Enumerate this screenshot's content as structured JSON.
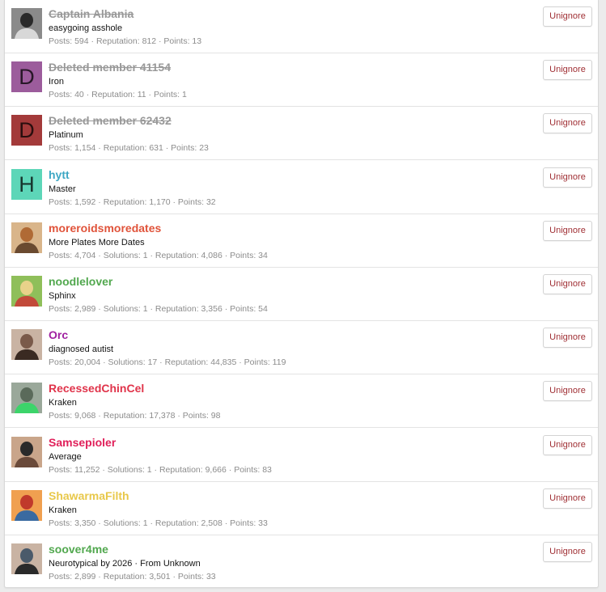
{
  "button_label": "Unignore",
  "members": [
    {
      "name": "Captain Albania",
      "deleted": true,
      "name_color": "#999999",
      "title": "easygoing asshole",
      "stats": "Posts: 594 · Reputation: 812 · Points: 13",
      "avatar": {
        "type": "photo",
        "icon": "avatar-photo-icon",
        "colors": [
          "#2a2a2a",
          "#8a8a8a",
          "#d8d8d8"
        ]
      }
    },
    {
      "name": "Deleted member 41154",
      "deleted": true,
      "name_color": "#999999",
      "title": "Iron",
      "stats": "Posts: 40 · Reputation: 11 · Points: 1",
      "avatar": {
        "type": "letter",
        "letter": "D",
        "bg": "#9c5c9c"
      }
    },
    {
      "name": "Deleted member 62432",
      "deleted": true,
      "name_color": "#999999",
      "title": "Platinum",
      "stats": "Posts: 1,154 · Reputation: 631 · Points: 23",
      "avatar": {
        "type": "letter",
        "letter": "D",
        "bg": "#a33a3a"
      }
    },
    {
      "name": "hytt",
      "deleted": false,
      "name_color": "#3ea7c4",
      "title": "Master",
      "stats": "Posts: 1,592 · Reputation: 1,170 · Points: 32",
      "avatar": {
        "type": "letter",
        "letter": "H",
        "bg": "#5dd6b8"
      }
    },
    {
      "name": "moreroidsmoredates",
      "deleted": false,
      "name_color": "#e0533a",
      "title": "More Plates More Dates",
      "stats": "Posts: 4,704 · Solutions: 1 · Reputation: 4,086 · Points: 34",
      "avatar": {
        "type": "photo",
        "icon": "avatar-photo-icon",
        "colors": [
          "#b06a35",
          "#d9b58a",
          "#6a4a30"
        ]
      }
    },
    {
      "name": "noodlelover",
      "deleted": false,
      "name_color": "#52a84f",
      "title": "Sphinx",
      "stats": "Posts: 2,989 · Solutions: 1 · Reputation: 3,356 · Points: 54",
      "avatar": {
        "type": "photo",
        "icon": "avatar-photo-icon",
        "colors": [
          "#e8d28a",
          "#8fbf5a",
          "#c24a3a"
        ]
      }
    },
    {
      "name": "Orc",
      "deleted": false,
      "name_color": "#a020a0",
      "title": "diagnosed autist",
      "stats": "Posts: 20,004 · Solutions: 17 · Reputation: 44,835 · Points: 119",
      "avatar": {
        "type": "photo",
        "icon": "avatar-photo-icon",
        "colors": [
          "#7a5a4a",
          "#c9b3a3",
          "#3a2a22"
        ]
      }
    },
    {
      "name": "RecessedChinCel",
      "deleted": false,
      "name_color": "#e0334a",
      "title": "Kraken",
      "stats": "Posts: 9,068 · Reputation: 17,378 · Points: 98",
      "avatar": {
        "type": "photo",
        "icon": "avatar-photo-icon",
        "colors": [
          "#5a6a5a",
          "#9aa89a",
          "#3cd46a"
        ]
      }
    },
    {
      "name": "Samsepioler",
      "deleted": false,
      "name_color": "#e0205a",
      "title": "Average",
      "stats": "Posts: 11,252 · Solutions: 1 · Reputation: 9,666 · Points: 83",
      "avatar": {
        "type": "photo",
        "icon": "avatar-photo-icon",
        "colors": [
          "#2a2a2a",
          "#c9a58a",
          "#6a4a3a"
        ]
      }
    },
    {
      "name": "ShawarmaFilth",
      "deleted": false,
      "name_color": "#e8c84a",
      "title": "Kraken",
      "stats": "Posts: 3,350 · Solutions: 1 · Reputation: 2,508 · Points: 33",
      "avatar": {
        "type": "photo",
        "icon": "avatar-photo-icon",
        "colors": [
          "#c0392b",
          "#f0a050",
          "#3a6aa0"
        ]
      }
    },
    {
      "name": "soover4me",
      "deleted": false,
      "name_color": "#52a84f",
      "title": "Neurotypical by 2026 · From Unknown",
      "stats": "Posts: 2,899 · Reputation: 3,501 · Points: 33",
      "avatar": {
        "type": "photo",
        "icon": "avatar-photo-icon",
        "colors": [
          "#4a5a6a",
          "#c9b3a3",
          "#2a2a2a"
        ]
      }
    }
  ]
}
